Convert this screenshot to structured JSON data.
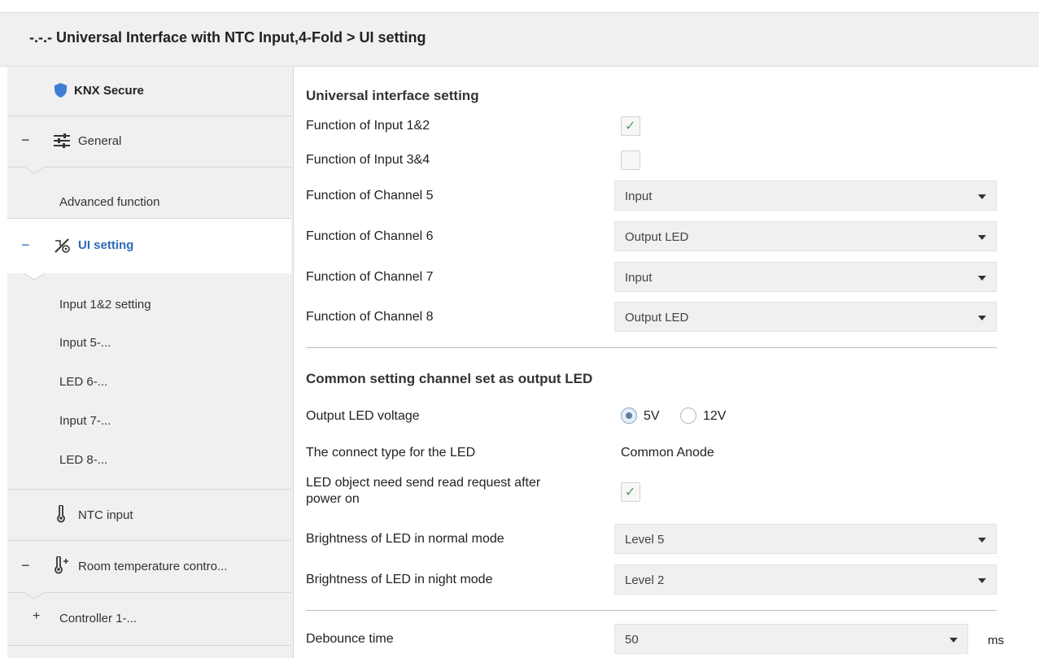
{
  "header": {
    "title": "-.-.- Universal Interface with NTC Input,4-Fold > UI setting"
  },
  "sidebar": {
    "knx_secure": "KNX Secure",
    "general": "General",
    "general_sign": "−",
    "advanced_function": "Advanced function",
    "ui_setting": "UI setting",
    "ui_setting_sign": "−",
    "input12": "Input 1&2 setting",
    "input5": "Input 5-...",
    "led6": "LED 6-...",
    "input7": "Input 7-...",
    "led8": "LED 8-...",
    "ntc_input": "NTC input",
    "room_temp": "Room temperature contro...",
    "room_temp_sign": "−",
    "controller1": "Controller 1-...",
    "controller1_sign": "+"
  },
  "main": {
    "section1_title": "Universal interface setting",
    "func_input12": {
      "label": "Function of Input 1&2",
      "checked": true
    },
    "func_input34": {
      "label": "Function of Input 3&4",
      "checked": false
    },
    "channel5": {
      "label": "Function of Channel 5",
      "value": "Input"
    },
    "channel6": {
      "label": "Function of Channel 6",
      "value": "Output LED"
    },
    "channel7": {
      "label": "Function of Channel 7",
      "value": "Input"
    },
    "channel8": {
      "label": "Function of Channel 8",
      "value": "Output LED"
    },
    "section2_title": "Common setting channel set as output LED",
    "led_voltage": {
      "label": "Output LED voltage",
      "option1": "5V",
      "option2": "12V",
      "selected": "5V"
    },
    "connect_type": {
      "label": "The connect type for the LED",
      "value": "Common Anode"
    },
    "read_request": {
      "label_line1": "LED object need send read request after",
      "label_line2": "power on",
      "checked": true
    },
    "brightness_normal": {
      "label": "Brightness of LED in normal mode",
      "value": "Level 5"
    },
    "brightness_night": {
      "label": "Brightness of LED in night mode",
      "value": "Level 2"
    },
    "debounce": {
      "label": "Debounce time",
      "value": "50",
      "unit": "ms"
    },
    "check_glyph": "✓"
  },
  "colors": {
    "accent": "#2b6cb8",
    "sidebar_bg": "#f0f0f0",
    "dropdown_bg": "#f0f0f0",
    "check": "#5a9a5a"
  }
}
